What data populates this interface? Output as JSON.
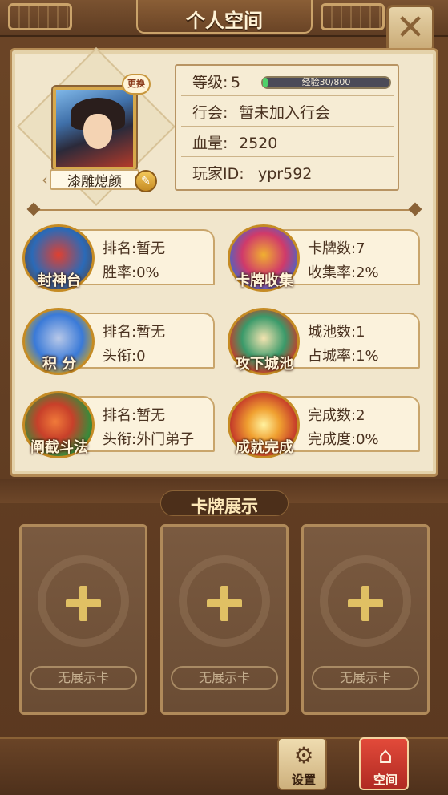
{
  "window": {
    "title": "个人空间"
  },
  "profile": {
    "name": "漆雕熄颜",
    "change_label": "更换",
    "level_label": "等级:",
    "level_value": "5",
    "xp_text": "经验30/800",
    "xp_progress": 0.0375,
    "guild_label": "行会:",
    "guild_value": "暂未加入行会",
    "hp_label": "血量:",
    "hp_value": "2520",
    "player_id_label": "玩家ID:",
    "player_id_value": "ypr592"
  },
  "stats": [
    {
      "name": "封神台",
      "line1_label": "排名:",
      "line1_value": "暂无",
      "line2_label": "胜率:",
      "line2_value": "0%"
    },
    {
      "name": "卡牌收集",
      "line1_label": "卡牌数:",
      "line1_value": "7",
      "line2_label": "收集率:",
      "line2_value": "2%"
    },
    {
      "name": "积 分",
      "line1_label": "排名:",
      "line1_value": "暂无",
      "line2_label": "头衔:",
      "line2_value": "0"
    },
    {
      "name": "攻下城池",
      "line1_label": "城池数:",
      "line1_value": "1",
      "line2_label": "占城率:",
      "line2_value": "1%"
    },
    {
      "name": "阐截斗法",
      "line1_label": "排名:",
      "line1_value": "暂无",
      "line2_label": "头衔:",
      "line2_value": "外门弟子"
    },
    {
      "name": "成就完成",
      "line1_label": "完成数:",
      "line1_value": "2",
      "line2_label": "完成度:",
      "line2_value": "0%"
    }
  ],
  "card_display": {
    "title": "卡牌展示",
    "slots": [
      {
        "empty_label": "无展示卡"
      },
      {
        "empty_label": "无展示卡"
      },
      {
        "empty_label": "无展示卡"
      }
    ]
  },
  "nav": {
    "settings_label": "设置",
    "space_label": "空间"
  },
  "colors": {
    "parchment": "#f1e6cc",
    "frame_brown": "#6b4526",
    "gold": "#c9a56b",
    "xp_green": "#4fd06a",
    "active_nav": "#c8312a"
  }
}
